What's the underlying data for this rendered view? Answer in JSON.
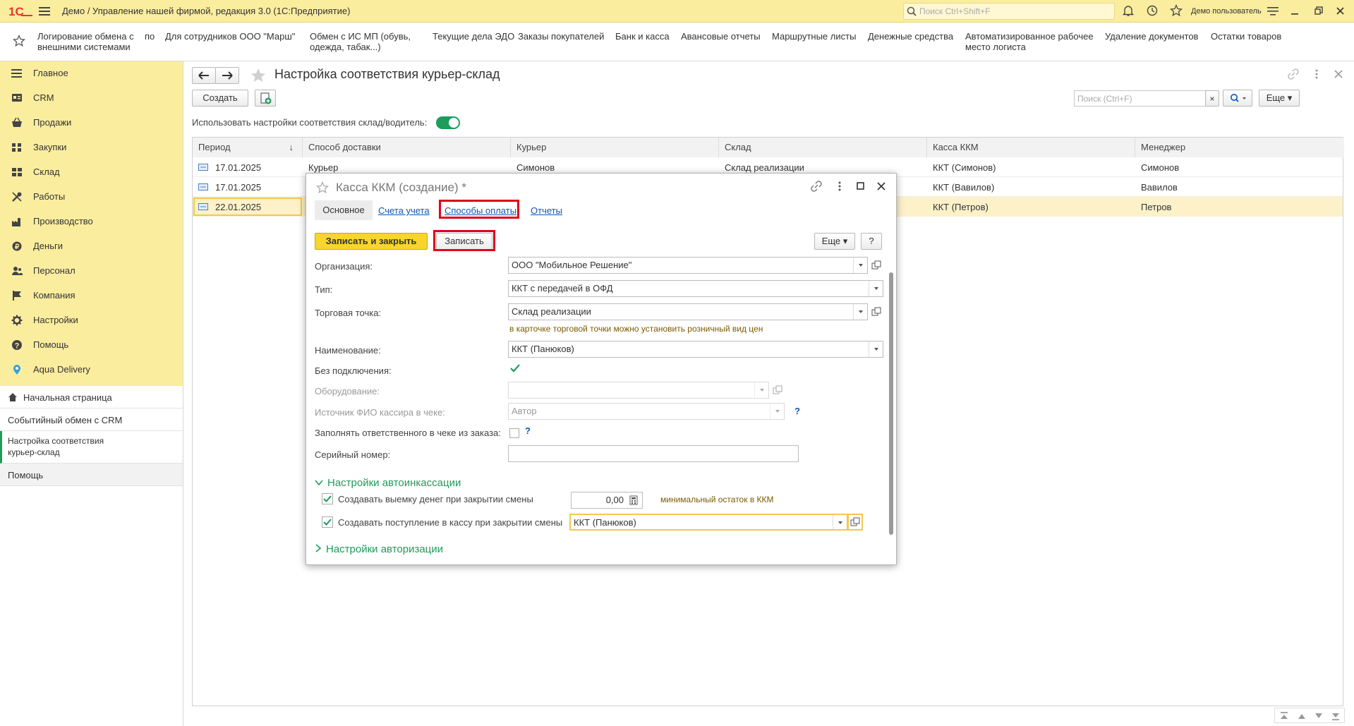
{
  "app": {
    "title": "Демо / Управление нашей фирмой, редакция 3.0  (1С:Предприятие)",
    "search_placeholder": "Поиск Ctrl+Shift+F",
    "user": "Демо пользователь",
    "brand_color": "#e8352b"
  },
  "favorites": [
    {
      "l1": "Логирование обмена с",
      "l2": "внешними системами"
    },
    {
      "l1": "по",
      "l2": ""
    },
    {
      "l1": "Для сотрудников ООО \"Марш\"",
      "l2": ""
    },
    {
      "l1": "Обмен с ИС МП (обувь,",
      "l2": "одежда, табак...)"
    },
    {
      "l1": "Текущие дела ЭДО",
      "l2": ""
    },
    {
      "l1": "Заказы покупателей",
      "l2": ""
    },
    {
      "l1": "Банк и касса",
      "l2": ""
    },
    {
      "l1": "Авансовые отчеты",
      "l2": ""
    },
    {
      "l1": "Маршрутные листы",
      "l2": ""
    },
    {
      "l1": "Денежные средства",
      "l2": ""
    },
    {
      "l1": "Автоматизированное рабочее",
      "l2": "место логиста"
    },
    {
      "l1": "Удаление документов",
      "l2": ""
    },
    {
      "l1": "Остатки товаров",
      "l2": ""
    }
  ],
  "sections": [
    {
      "label": "Главное",
      "icon": "menu-icon"
    },
    {
      "label": "CRM",
      "icon": "crm-icon"
    },
    {
      "label": "Продажи",
      "icon": "basket-icon"
    },
    {
      "label": "Закупки",
      "icon": "purchase-icon"
    },
    {
      "label": "Склад",
      "icon": "warehouse-icon"
    },
    {
      "label": "Работы",
      "icon": "tools-icon"
    },
    {
      "label": "Производство",
      "icon": "factory-icon"
    },
    {
      "label": "Деньги",
      "icon": "money-icon"
    },
    {
      "label": "Персонал",
      "icon": "people-icon"
    },
    {
      "label": "Компания",
      "icon": "flag-icon"
    },
    {
      "label": "Настройки",
      "icon": "gear-icon"
    },
    {
      "label": "Помощь",
      "icon": "help-icon"
    },
    {
      "label": "Aqua Delivery",
      "icon": "location-icon"
    }
  ],
  "open_windows": {
    "home": "Начальная страница",
    "crm_exchange": "Событийный обмен с CRM",
    "current_l1": "Настройка соответствия",
    "current_l2": "курьер-склад",
    "help": "Помощь"
  },
  "form": {
    "title": "Настройка соответствия курьер-склад",
    "create": "Создать",
    "search_placeholder": "Поиск (Ctrl+F)",
    "more": "Еще",
    "toggle_label": "Использовать настройки соответствия склад/водитель:",
    "toggle_on": true
  },
  "table": {
    "columns": [
      "Период",
      "Способ доставки",
      "Курьер",
      "Склад",
      "Касса ККМ",
      "Менеджер"
    ],
    "rows": [
      {
        "period": "17.01.2025",
        "delivery": "Курьер",
        "courier": "Симонов",
        "warehouse": "Склад реализации",
        "kkm": "ККТ (Симонов)",
        "manager": "Симонов"
      },
      {
        "period": "17.01.2025",
        "delivery": "",
        "courier": "",
        "warehouse": "",
        "kkm": "ККТ (Вавилов)",
        "manager": "Вавилов"
      },
      {
        "period": "22.01.2025",
        "delivery": "",
        "courier": "",
        "warehouse": "",
        "kkm": "ККТ (Петров)",
        "manager": "Петров"
      }
    ]
  },
  "dialog": {
    "title": "Касса ККМ (создание) *",
    "tabs": [
      "Основное",
      "Счета учета",
      "Способы оплаты",
      "Отчеты"
    ],
    "save_close": "Записать и закрыть",
    "save": "Записать",
    "more": "Еще",
    "help": "?",
    "org_label": "Организация:",
    "org_value": "ООО \"Мобильное Решение\"",
    "type_label": "Тип:",
    "type_value": "ККТ с передачей в ОФД",
    "point_label": "Торговая точка:",
    "point_value": "Склад реализации",
    "point_hint": "в карточке торговой точки можно установить розничный вид цен",
    "name_label": "Наименование:",
    "name_value": "ККТ (Панюков)",
    "offline_label": "Без подключения:",
    "equipment_label": "Оборудование:",
    "cashier_label": "Источник ФИО кассира в чеке:",
    "cashier_value": "Автор",
    "responsible_label": "Заполнять ответственного в чеке из заказа:",
    "serial_label": "Серийный номер:",
    "autocollect_title": "Настройки автоинкассации",
    "withdraw_label": "Создавать выемку денег при закрытии смены",
    "withdraw_amount": "0,00",
    "withdraw_hint": "минимальный остаток в ККМ",
    "receipt_label": "Создавать поступление в кассу при закрытии смены",
    "receipt_value": "ККТ (Панюков)",
    "auth_title": "Настройки авторизации",
    "accent_color": "#1c9d5b",
    "highlight_color": "#e0001b"
  }
}
